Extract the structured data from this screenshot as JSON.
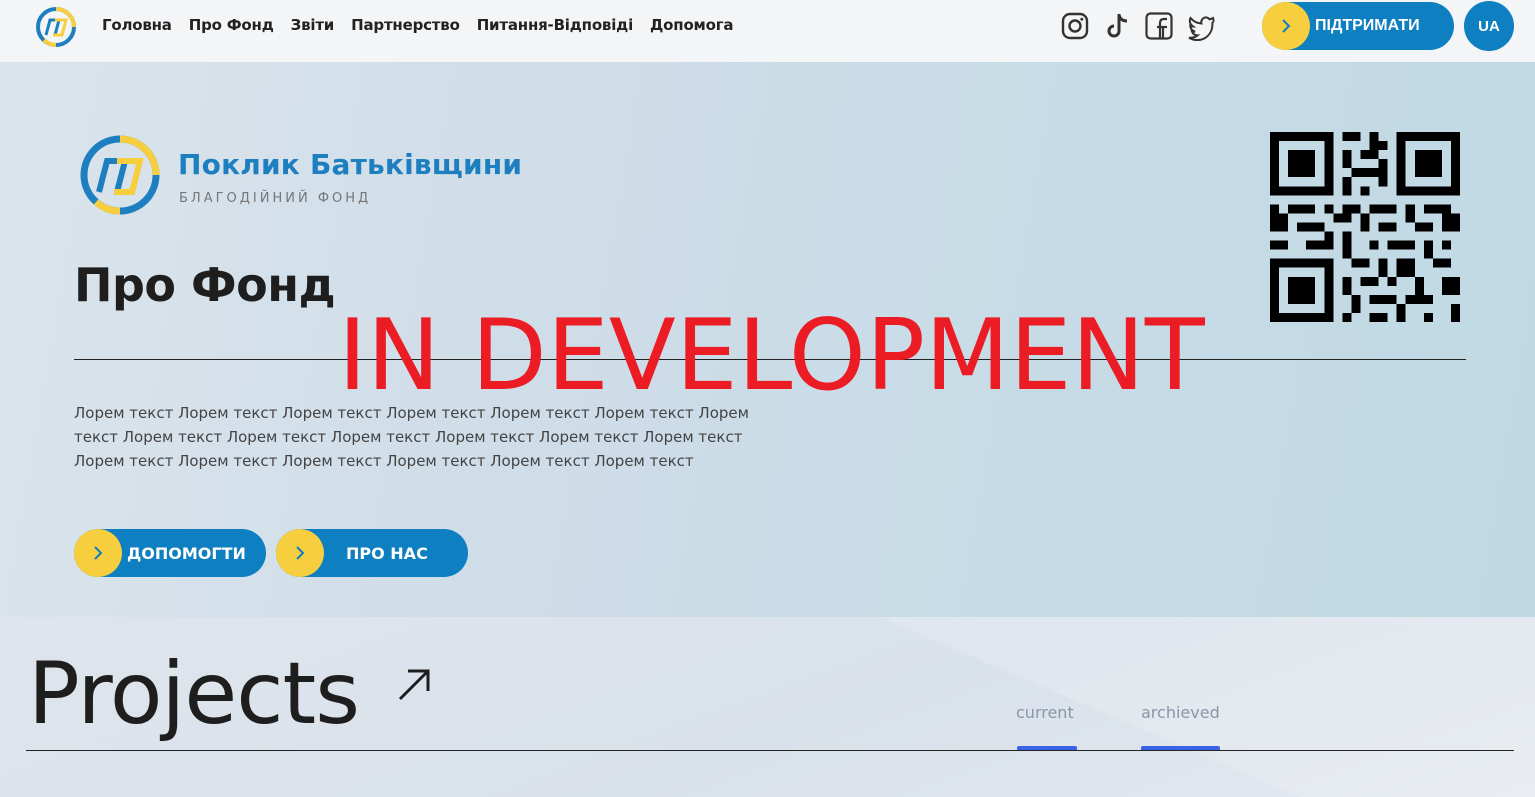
{
  "header": {
    "nav": [
      "Головна",
      "Про Фонд",
      "Звіти",
      "Партнерство",
      "Питання-Відповіді",
      "Допомога"
    ],
    "socials": [
      "instagram-icon",
      "tiktok-icon",
      "facebook-icon",
      "twitter-icon"
    ],
    "support_label": "ПІДТРИМАТИ",
    "lang_label": "UA"
  },
  "hero": {
    "brand_name": "Поклик Батьківщини",
    "brand_sub": "БЛАГОДІЙНИЙ ФОНД",
    "title": "Про Фонд",
    "dev_banner": "IN DEVELOPMENT",
    "text": "Лорем текст Лорем текст Лорем текст Лорем текст Лорем текст Лорем текст Лорем текст Лорем текст Лорем текст Лорем текст Лорем текст Лорем текст Лорем текст Лорем текст Лорем текст Лорем текст Лорем текст Лорем текст Лорем текст",
    "help_label": "ДОПОМОГТИ",
    "about_label": "ПРО НАС"
  },
  "projects": {
    "title": "Projects",
    "tabs": [
      "current",
      "archieved"
    ]
  },
  "colors": {
    "brand_blue": "#0e7fc0",
    "brand_yellow": "#f7ce3e",
    "banner_red": "#ec1c24",
    "tab_indicator": "#3b63e8"
  }
}
